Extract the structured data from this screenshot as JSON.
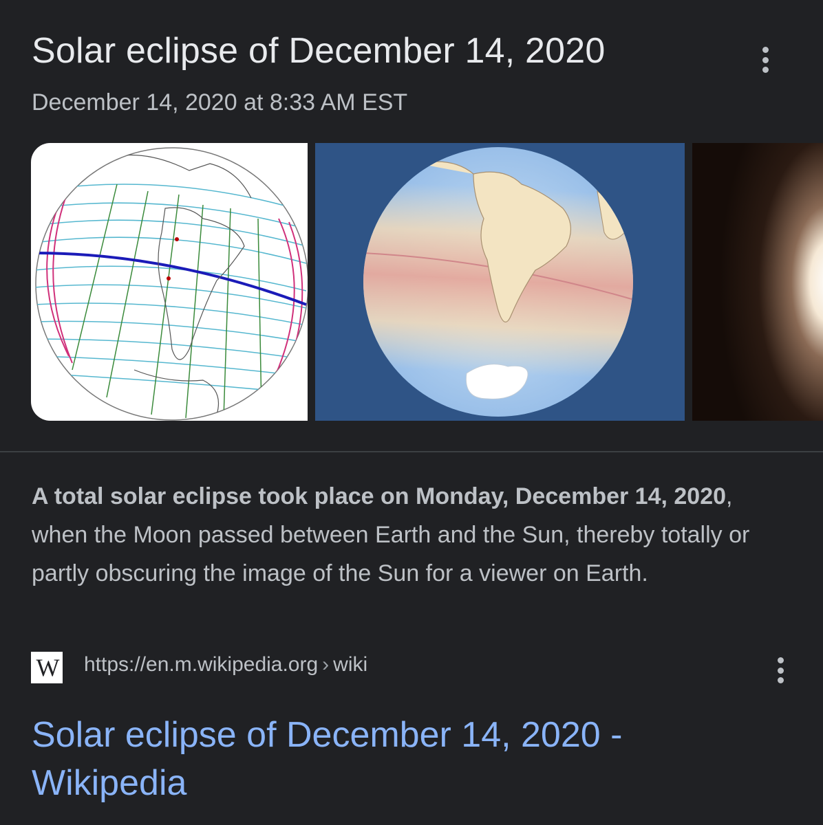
{
  "event": {
    "title": "Solar eclipse of December 14, 2020",
    "datetime": "December 14, 2020 at 8:33 AM EST"
  },
  "snippet": {
    "bold_text": "A total solar eclipse took place on Monday, December 14, 2020",
    "rest_text": ", when the Moon passed between Earth and the Sun, thereby totally or partly obscuring the image of the Sun for a viewer on Earth."
  },
  "result": {
    "favicon_letter": "W",
    "url": "https://en.m.wikipedia.org",
    "breadcrumb_separator": "›",
    "breadcrumb": "wiki",
    "title": "Solar eclipse of December 14, 2020 - Wikipedia"
  },
  "images": [
    {
      "name": "eclipse-path-map-image"
    },
    {
      "name": "eclipse-globe-shading-image"
    },
    {
      "name": "eclipse-photo-image"
    }
  ],
  "icons": {
    "more_top": "more-vert-icon",
    "more_result": "more-vert-icon"
  },
  "colors": {
    "background": "#202124",
    "title": "#e8eaed",
    "text": "#bdc1c6",
    "link": "#8ab4f8",
    "divider": "#3c4043"
  }
}
